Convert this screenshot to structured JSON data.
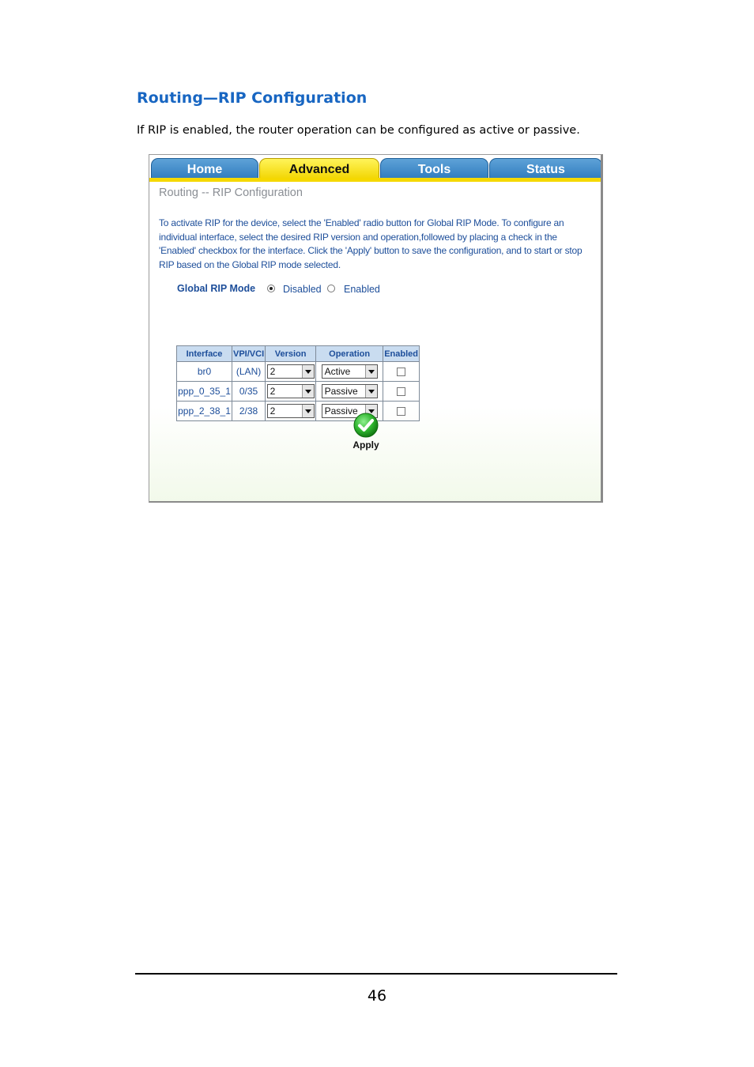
{
  "doc": {
    "heading": "Routing—RIP Configuration",
    "intro": "If RIP is enabled, the router operation can be configured as active or passive.",
    "page_number": "46"
  },
  "ui": {
    "tabs": [
      {
        "label": "Home",
        "active": false
      },
      {
        "label": "Advanced",
        "active": true
      },
      {
        "label": "Tools",
        "active": false
      },
      {
        "label": "Status",
        "active": false
      }
    ],
    "page_title": "Routing -- RIP Configuration",
    "description": "To activate RIP for the device, select the 'Enabled' radio button for Global RIP Mode. To configure an individual interface, select the desired RIP version and operation,followed by placing a check in the 'Enabled' checkbox for the interface. Click the 'Apply' button to save the configuration, and to start or stop RIP based on the Global RIP mode selected.",
    "global_mode": {
      "label": "Global RIP Mode",
      "options": [
        "Disabled",
        "Enabled"
      ],
      "selected": "Disabled"
    },
    "table": {
      "headers": [
        "Interface",
        "VPI/VCI",
        "Version",
        "Operation",
        "Enabled"
      ],
      "rows": [
        {
          "interface": "br0",
          "vpivci": "(LAN)",
          "version": "2",
          "operation": "Active",
          "enabled": false
        },
        {
          "interface": "ppp_0_35_1",
          "vpivci": "0/35",
          "version": "2",
          "operation": "Passive",
          "enabled": false
        },
        {
          "interface": "ppp_2_38_1",
          "vpivci": "2/38",
          "version": "2",
          "operation": "Passive",
          "enabled": false
        }
      ]
    },
    "apply_label": "Apply",
    "colors": {
      "tab_blue": "#2f7bbd",
      "tab_active": "#f5d800",
      "text_blue": "#1d4e9a",
      "heading_blue": "#1866c2",
      "apply_green": "#2fb52f"
    }
  }
}
